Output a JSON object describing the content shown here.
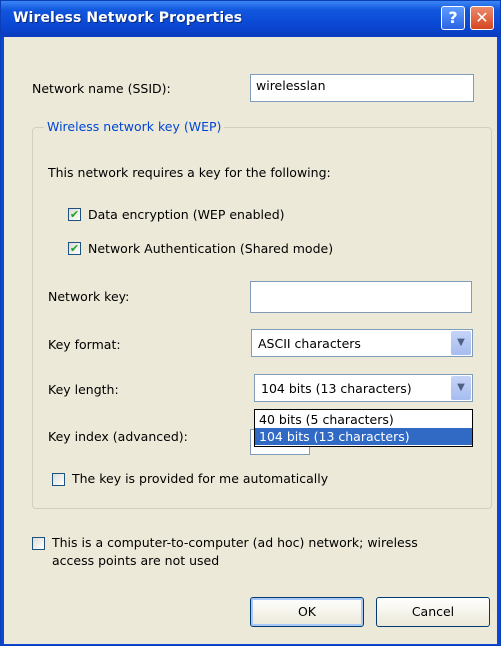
{
  "window": {
    "title": "Wireless Network Properties",
    "help_glyph": "?",
    "close_glyph": "✕"
  },
  "ssid": {
    "label": "Network name (SSID):",
    "value": "wirelesslan"
  },
  "wep_group": {
    "title": "Wireless network key (WEP)",
    "requires_text": "This network requires a key for the following:",
    "data_encryption": {
      "label": "Data encryption (WEP enabled)",
      "checked": true
    },
    "network_auth": {
      "label": "Network Authentication (Shared mode)",
      "checked": true
    },
    "network_key": {
      "label": "Network key:",
      "value": ""
    },
    "key_format": {
      "label": "Key format:",
      "value": "ASCII characters"
    },
    "key_length": {
      "label": "Key length:",
      "value": "104 bits (13 characters)",
      "options": [
        "40 bits (5 characters)",
        "104 bits (13 characters)"
      ]
    },
    "key_index": {
      "label": "Key index (advanced):"
    },
    "auto_key": {
      "label": "The key is provided for me automatically",
      "checked": false
    }
  },
  "adhoc": {
    "label_line1": "This is a computer-to-computer (ad hoc) network; wireless",
    "label_line2": "access points are not used",
    "checked": false
  },
  "buttons": {
    "ok": "OK",
    "cancel": "Cancel"
  },
  "icons": {
    "check": "✔",
    "dropdown_arrow": "▼"
  },
  "colors": {
    "title_bar": "#0a46d8",
    "group_title": "#0046d5",
    "selection": "#316ac5"
  }
}
